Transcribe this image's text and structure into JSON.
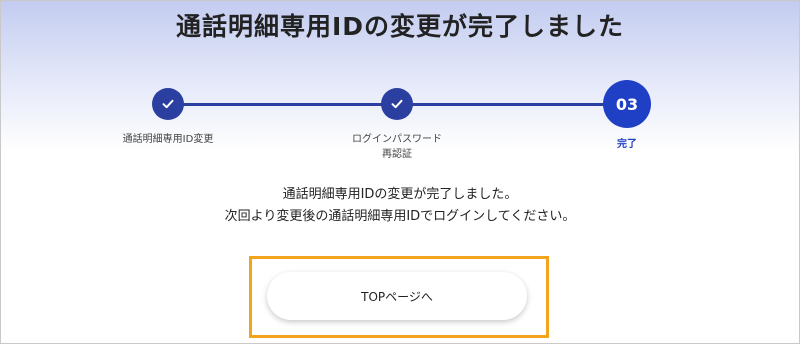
{
  "page": {
    "title": "通話明細専用IDの変更が完了しました"
  },
  "stepper": {
    "steps": [
      {
        "label": "通話明細専用ID変更",
        "state": "done",
        "icon": "check-icon"
      },
      {
        "label_line1": "ログインパスワード",
        "label_line2": "再認証",
        "state": "done",
        "icon": "check-icon"
      },
      {
        "number": "03",
        "label": "完了",
        "state": "current"
      }
    ],
    "colors": {
      "done": "#2a3fa0",
      "current": "#1f3fc4",
      "line": "#2a3fa0"
    }
  },
  "message": {
    "line1": "通話明細専用IDの変更が完了しました。",
    "line2": "次回より変更後の通話明細専用IDでログインしてください。"
  },
  "actions": {
    "top_button_label": "TOPページへ",
    "highlight_color": "#f2a51c"
  }
}
